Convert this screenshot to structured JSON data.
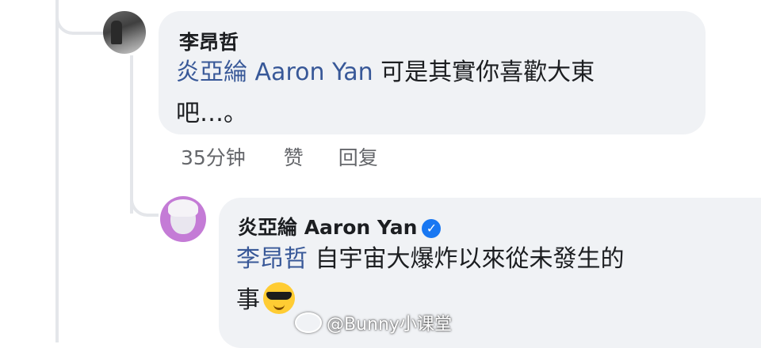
{
  "comment_1": {
    "author": "李昂哲",
    "mention": "炎亞綸 Aaron Yan",
    "text_line1": " 可是其實你喜歡大東",
    "text_line2": "吧…。"
  },
  "comment_1_meta": {
    "time": "35分钟",
    "like_label": "赞",
    "reply_label": "回复"
  },
  "comment_2": {
    "author": "炎亞綸 Aaron Yan",
    "verified_icon": "verified-badge-icon",
    "mention": "李昂哲",
    "text_line1": " 自宇宙大爆炸以來從未發生的",
    "text_line2": "事",
    "emoji": "sunglasses-face-icon"
  },
  "watermark": {
    "text": "@Bunny小课堂",
    "icon": "weibo-icon"
  },
  "colors": {
    "bubble": "#f0f2f5",
    "mention": "#385898",
    "meta": "#65676b",
    "verified": "#1877f2"
  }
}
